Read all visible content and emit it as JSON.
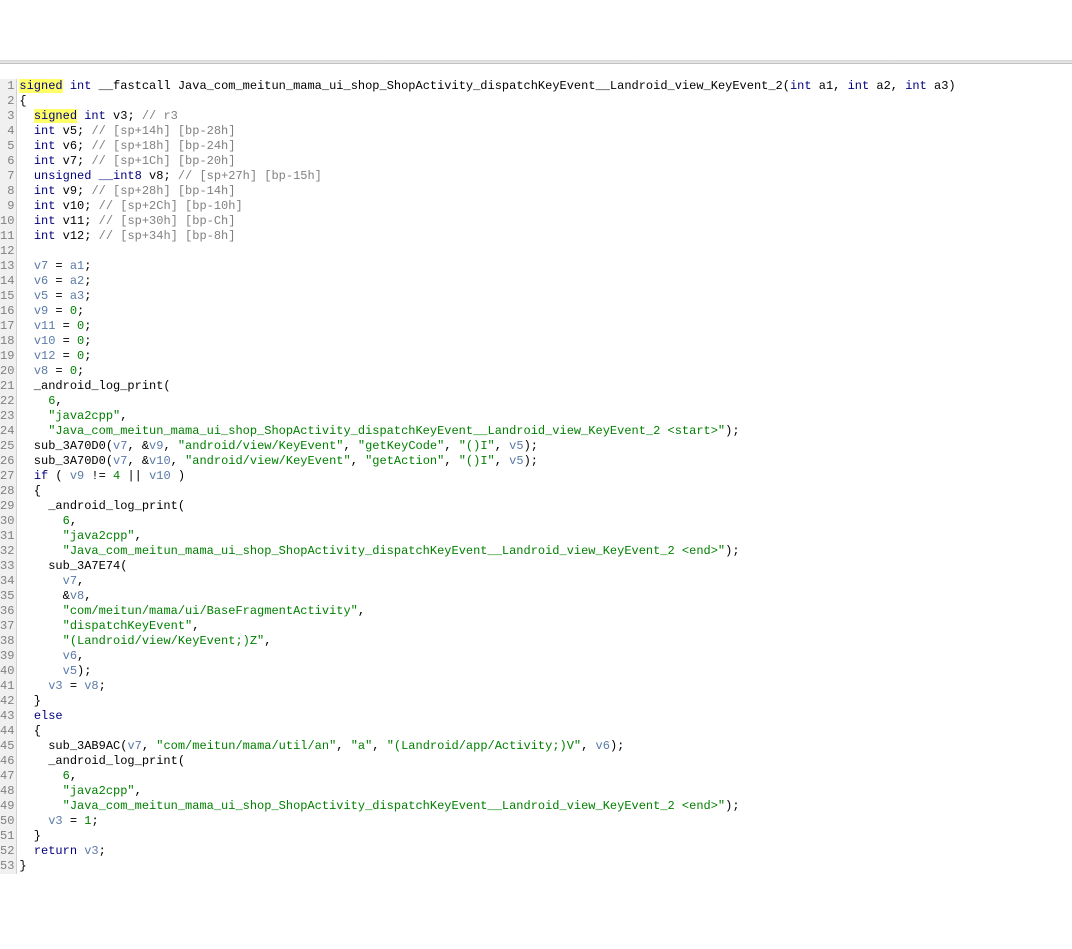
{
  "lines": [
    {
      "num": "1",
      "tokens": [
        {
          "c": "kw hl",
          "t": "signed"
        },
        {
          "c": "punct",
          "t": " "
        },
        {
          "c": "kw",
          "t": "int"
        },
        {
          "c": "punct",
          "t": " __fastcall "
        },
        {
          "c": "fn-name",
          "t": "Java_com_meitun_mama_ui_shop_ShopActivity_dispatchKeyEvent__Landroid_view_KeyEvent_2"
        },
        {
          "c": "punct",
          "t": "("
        },
        {
          "c": "kw",
          "t": "int"
        },
        {
          "c": "punct",
          "t": " a1, "
        },
        {
          "c": "kw",
          "t": "int"
        },
        {
          "c": "punct",
          "t": " a2, "
        },
        {
          "c": "kw",
          "t": "int"
        },
        {
          "c": "punct",
          "t": " a3)"
        }
      ]
    },
    {
      "num": "2",
      "tokens": [
        {
          "c": "punct",
          "t": "{"
        }
      ]
    },
    {
      "num": "3",
      "tokens": [
        {
          "c": "punct",
          "t": "  "
        },
        {
          "c": "kw hl",
          "t": "signed"
        },
        {
          "c": "punct",
          "t": " "
        },
        {
          "c": "kw",
          "t": "int"
        },
        {
          "c": "punct",
          "t": " v3; "
        },
        {
          "c": "comment",
          "t": "// r3"
        }
      ]
    },
    {
      "num": "4",
      "tokens": [
        {
          "c": "punct",
          "t": "  "
        },
        {
          "c": "kw",
          "t": "int"
        },
        {
          "c": "punct",
          "t": " v5; "
        },
        {
          "c": "comment",
          "t": "// [sp+14h] [bp-28h]"
        }
      ]
    },
    {
      "num": "5",
      "tokens": [
        {
          "c": "punct",
          "t": "  "
        },
        {
          "c": "kw",
          "t": "int"
        },
        {
          "c": "punct",
          "t": " v6; "
        },
        {
          "c": "comment",
          "t": "// [sp+18h] [bp-24h]"
        }
      ]
    },
    {
      "num": "6",
      "tokens": [
        {
          "c": "punct",
          "t": "  "
        },
        {
          "c": "kw",
          "t": "int"
        },
        {
          "c": "punct",
          "t": " v7; "
        },
        {
          "c": "comment",
          "t": "// [sp+1Ch] [bp-20h]"
        }
      ]
    },
    {
      "num": "7",
      "tokens": [
        {
          "c": "punct",
          "t": "  "
        },
        {
          "c": "kw",
          "t": "unsigned"
        },
        {
          "c": "punct",
          "t": " "
        },
        {
          "c": "kw",
          "t": "__int8"
        },
        {
          "c": "punct",
          "t": " v8; "
        },
        {
          "c": "comment",
          "t": "// [sp+27h] [bp-15h]"
        }
      ]
    },
    {
      "num": "8",
      "tokens": [
        {
          "c": "punct",
          "t": "  "
        },
        {
          "c": "kw",
          "t": "int"
        },
        {
          "c": "punct",
          "t": " v9; "
        },
        {
          "c": "comment",
          "t": "// [sp+28h] [bp-14h]"
        }
      ]
    },
    {
      "num": "9",
      "tokens": [
        {
          "c": "punct",
          "t": "  "
        },
        {
          "c": "kw",
          "t": "int"
        },
        {
          "c": "punct",
          "t": " v10; "
        },
        {
          "c": "comment",
          "t": "// [sp+2Ch] [bp-10h]"
        }
      ]
    },
    {
      "num": "10",
      "tokens": [
        {
          "c": "punct",
          "t": "  "
        },
        {
          "c": "kw",
          "t": "int"
        },
        {
          "c": "punct",
          "t": " v11; "
        },
        {
          "c": "comment",
          "t": "// [sp+30h] [bp-Ch]"
        }
      ]
    },
    {
      "num": "11",
      "tokens": [
        {
          "c": "punct",
          "t": "  "
        },
        {
          "c": "kw",
          "t": "int"
        },
        {
          "c": "punct",
          "t": " v12; "
        },
        {
          "c": "comment",
          "t": "// [sp+34h] [bp-8h]"
        }
      ]
    },
    {
      "num": "12",
      "tokens": [
        {
          "c": "punct",
          "t": ""
        }
      ]
    },
    {
      "num": "13",
      "tokens": [
        {
          "c": "punct",
          "t": "  "
        },
        {
          "c": "var",
          "t": "v7"
        },
        {
          "c": "punct",
          "t": " = "
        },
        {
          "c": "var",
          "t": "a1"
        },
        {
          "c": "punct",
          "t": ";"
        }
      ]
    },
    {
      "num": "14",
      "tokens": [
        {
          "c": "punct",
          "t": "  "
        },
        {
          "c": "var",
          "t": "v6"
        },
        {
          "c": "punct",
          "t": " = "
        },
        {
          "c": "var",
          "t": "a2"
        },
        {
          "c": "punct",
          "t": ";"
        }
      ]
    },
    {
      "num": "15",
      "tokens": [
        {
          "c": "punct",
          "t": "  "
        },
        {
          "c": "var",
          "t": "v5"
        },
        {
          "c": "punct",
          "t": " = "
        },
        {
          "c": "var",
          "t": "a3"
        },
        {
          "c": "punct",
          "t": ";"
        }
      ]
    },
    {
      "num": "16",
      "tokens": [
        {
          "c": "punct",
          "t": "  "
        },
        {
          "c": "var",
          "t": "v9"
        },
        {
          "c": "punct",
          "t": " = "
        },
        {
          "c": "num",
          "t": "0"
        },
        {
          "c": "punct",
          "t": ";"
        }
      ]
    },
    {
      "num": "17",
      "tokens": [
        {
          "c": "punct",
          "t": "  "
        },
        {
          "c": "var",
          "t": "v11"
        },
        {
          "c": "punct",
          "t": " = "
        },
        {
          "c": "num",
          "t": "0"
        },
        {
          "c": "punct",
          "t": ";"
        }
      ]
    },
    {
      "num": "18",
      "tokens": [
        {
          "c": "punct",
          "t": "  "
        },
        {
          "c": "var",
          "t": "v10"
        },
        {
          "c": "punct",
          "t": " = "
        },
        {
          "c": "num",
          "t": "0"
        },
        {
          "c": "punct",
          "t": ";"
        }
      ]
    },
    {
      "num": "19",
      "tokens": [
        {
          "c": "punct",
          "t": "  "
        },
        {
          "c": "var",
          "t": "v12"
        },
        {
          "c": "punct",
          "t": " = "
        },
        {
          "c": "num",
          "t": "0"
        },
        {
          "c": "punct",
          "t": ";"
        }
      ]
    },
    {
      "num": "20",
      "tokens": [
        {
          "c": "punct",
          "t": "  "
        },
        {
          "c": "var",
          "t": "v8"
        },
        {
          "c": "punct",
          "t": " = "
        },
        {
          "c": "num",
          "t": "0"
        },
        {
          "c": "punct",
          "t": ";"
        }
      ]
    },
    {
      "num": "21",
      "tokens": [
        {
          "c": "punct",
          "t": "  _android_log_print("
        }
      ]
    },
    {
      "num": "22",
      "tokens": [
        {
          "c": "punct",
          "t": "    "
        },
        {
          "c": "num",
          "t": "6"
        },
        {
          "c": "punct",
          "t": ","
        }
      ]
    },
    {
      "num": "23",
      "tokens": [
        {
          "c": "punct",
          "t": "    "
        },
        {
          "c": "str",
          "t": "\"java2cpp\""
        },
        {
          "c": "punct",
          "t": ","
        }
      ]
    },
    {
      "num": "24",
      "tokens": [
        {
          "c": "punct",
          "t": "    "
        },
        {
          "c": "str",
          "t": "\"Java_com_meitun_mama_ui_shop_ShopActivity_dispatchKeyEvent__Landroid_view_KeyEvent_2 <start>\""
        },
        {
          "c": "punct",
          "t": ");"
        }
      ]
    },
    {
      "num": "25",
      "tokens": [
        {
          "c": "punct",
          "t": "  sub_3A70D0("
        },
        {
          "c": "var",
          "t": "v7"
        },
        {
          "c": "punct",
          "t": ", &"
        },
        {
          "c": "var",
          "t": "v9"
        },
        {
          "c": "punct",
          "t": ", "
        },
        {
          "c": "str",
          "t": "\"android/view/KeyEvent\""
        },
        {
          "c": "punct",
          "t": ", "
        },
        {
          "c": "str",
          "t": "\"getKeyCode\""
        },
        {
          "c": "punct",
          "t": ", "
        },
        {
          "c": "str",
          "t": "\"()I\""
        },
        {
          "c": "punct",
          "t": ", "
        },
        {
          "c": "var",
          "t": "v5"
        },
        {
          "c": "punct",
          "t": ");"
        }
      ]
    },
    {
      "num": "26",
      "tokens": [
        {
          "c": "punct",
          "t": "  sub_3A70D0("
        },
        {
          "c": "var",
          "t": "v7"
        },
        {
          "c": "punct",
          "t": ", &"
        },
        {
          "c": "var",
          "t": "v10"
        },
        {
          "c": "punct",
          "t": ", "
        },
        {
          "c": "str",
          "t": "\"android/view/KeyEvent\""
        },
        {
          "c": "punct",
          "t": ", "
        },
        {
          "c": "str",
          "t": "\"getAction\""
        },
        {
          "c": "punct",
          "t": ", "
        },
        {
          "c": "str",
          "t": "\"()I\""
        },
        {
          "c": "punct",
          "t": ", "
        },
        {
          "c": "var",
          "t": "v5"
        },
        {
          "c": "punct",
          "t": ");"
        }
      ]
    },
    {
      "num": "27",
      "tokens": [
        {
          "c": "punct",
          "t": "  "
        },
        {
          "c": "kw",
          "t": "if"
        },
        {
          "c": "punct",
          "t": " ( "
        },
        {
          "c": "var",
          "t": "v9"
        },
        {
          "c": "punct",
          "t": " != "
        },
        {
          "c": "num",
          "t": "4"
        },
        {
          "c": "punct",
          "t": " || "
        },
        {
          "c": "var",
          "t": "v10"
        },
        {
          "c": "punct",
          "t": " )"
        }
      ]
    },
    {
      "num": "28",
      "tokens": [
        {
          "c": "punct",
          "t": "  {"
        }
      ]
    },
    {
      "num": "29",
      "tokens": [
        {
          "c": "punct",
          "t": "    _android_log_print("
        }
      ]
    },
    {
      "num": "30",
      "tokens": [
        {
          "c": "punct",
          "t": "      "
        },
        {
          "c": "num",
          "t": "6"
        },
        {
          "c": "punct",
          "t": ","
        }
      ]
    },
    {
      "num": "31",
      "tokens": [
        {
          "c": "punct",
          "t": "      "
        },
        {
          "c": "str",
          "t": "\"java2cpp\""
        },
        {
          "c": "punct",
          "t": ","
        }
      ]
    },
    {
      "num": "32",
      "tokens": [
        {
          "c": "punct",
          "t": "      "
        },
        {
          "c": "str",
          "t": "\"Java_com_meitun_mama_ui_shop_ShopActivity_dispatchKeyEvent__Landroid_view_KeyEvent_2 <end>\""
        },
        {
          "c": "punct",
          "t": ");"
        }
      ]
    },
    {
      "num": "33",
      "tokens": [
        {
          "c": "punct",
          "t": "    sub_3A7E74("
        }
      ]
    },
    {
      "num": "34",
      "tokens": [
        {
          "c": "punct",
          "t": "      "
        },
        {
          "c": "var",
          "t": "v7"
        },
        {
          "c": "punct",
          "t": ","
        }
      ]
    },
    {
      "num": "35",
      "tokens": [
        {
          "c": "punct",
          "t": "      &"
        },
        {
          "c": "var",
          "t": "v8"
        },
        {
          "c": "punct",
          "t": ","
        }
      ]
    },
    {
      "num": "36",
      "tokens": [
        {
          "c": "punct",
          "t": "      "
        },
        {
          "c": "str",
          "t": "\"com/meitun/mama/ui/BaseFragmentActivity\""
        },
        {
          "c": "punct",
          "t": ","
        }
      ]
    },
    {
      "num": "37",
      "tokens": [
        {
          "c": "punct",
          "t": "      "
        },
        {
          "c": "str",
          "t": "\"dispatchKeyEvent\""
        },
        {
          "c": "punct",
          "t": ","
        }
      ]
    },
    {
      "num": "38",
      "tokens": [
        {
          "c": "punct",
          "t": "      "
        },
        {
          "c": "str",
          "t": "\"(Landroid/view/KeyEvent;)Z\""
        },
        {
          "c": "punct",
          "t": ","
        }
      ]
    },
    {
      "num": "39",
      "tokens": [
        {
          "c": "punct",
          "t": "      "
        },
        {
          "c": "var",
          "t": "v6"
        },
        {
          "c": "punct",
          "t": ","
        }
      ]
    },
    {
      "num": "40",
      "tokens": [
        {
          "c": "punct",
          "t": "      "
        },
        {
          "c": "var",
          "t": "v5"
        },
        {
          "c": "punct",
          "t": ");"
        }
      ]
    },
    {
      "num": "41",
      "tokens": [
        {
          "c": "punct",
          "t": "    "
        },
        {
          "c": "var",
          "t": "v3"
        },
        {
          "c": "punct",
          "t": " = "
        },
        {
          "c": "var",
          "t": "v8"
        },
        {
          "c": "punct",
          "t": ";"
        }
      ]
    },
    {
      "num": "42",
      "tokens": [
        {
          "c": "punct",
          "t": "  }"
        }
      ]
    },
    {
      "num": "43",
      "tokens": [
        {
          "c": "punct",
          "t": "  "
        },
        {
          "c": "kw",
          "t": "else"
        }
      ]
    },
    {
      "num": "44",
      "tokens": [
        {
          "c": "punct",
          "t": "  {"
        }
      ]
    },
    {
      "num": "45",
      "tokens": [
        {
          "c": "punct",
          "t": "    sub_3AB9AC("
        },
        {
          "c": "var",
          "t": "v7"
        },
        {
          "c": "punct",
          "t": ", "
        },
        {
          "c": "str",
          "t": "\"com/meitun/mama/util/an\""
        },
        {
          "c": "punct",
          "t": ", "
        },
        {
          "c": "str",
          "t": "\"a\""
        },
        {
          "c": "punct",
          "t": ", "
        },
        {
          "c": "str",
          "t": "\"(Landroid/app/Activity;)V\""
        },
        {
          "c": "punct",
          "t": ", "
        },
        {
          "c": "var",
          "t": "v6"
        },
        {
          "c": "punct",
          "t": ");"
        }
      ]
    },
    {
      "num": "46",
      "tokens": [
        {
          "c": "punct",
          "t": "    _android_log_print("
        }
      ]
    },
    {
      "num": "47",
      "tokens": [
        {
          "c": "punct",
          "t": "      "
        },
        {
          "c": "num",
          "t": "6"
        },
        {
          "c": "punct",
          "t": ","
        }
      ]
    },
    {
      "num": "48",
      "tokens": [
        {
          "c": "punct",
          "t": "      "
        },
        {
          "c": "str",
          "t": "\"java2cpp\""
        },
        {
          "c": "punct",
          "t": ","
        }
      ]
    },
    {
      "num": "49",
      "tokens": [
        {
          "c": "punct",
          "t": "      "
        },
        {
          "c": "str",
          "t": "\"Java_com_meitun_mama_ui_shop_ShopActivity_dispatchKeyEvent__Landroid_view_KeyEvent_2 <end>\""
        },
        {
          "c": "punct",
          "t": ");"
        }
      ]
    },
    {
      "num": "50",
      "tokens": [
        {
          "c": "punct",
          "t": "    "
        },
        {
          "c": "var",
          "t": "v3"
        },
        {
          "c": "punct",
          "t": " = "
        },
        {
          "c": "num",
          "t": "1"
        },
        {
          "c": "punct",
          "t": ";"
        }
      ]
    },
    {
      "num": "51",
      "tokens": [
        {
          "c": "punct",
          "t": "  }"
        }
      ]
    },
    {
      "num": "52",
      "tokens": [
        {
          "c": "punct",
          "t": "  "
        },
        {
          "c": "kw",
          "t": "return"
        },
        {
          "c": "punct",
          "t": " "
        },
        {
          "c": "var",
          "t": "v3"
        },
        {
          "c": "punct",
          "t": ";"
        }
      ]
    },
    {
      "num": "53",
      "tokens": [
        {
          "c": "punct",
          "t": "}"
        }
      ]
    }
  ]
}
